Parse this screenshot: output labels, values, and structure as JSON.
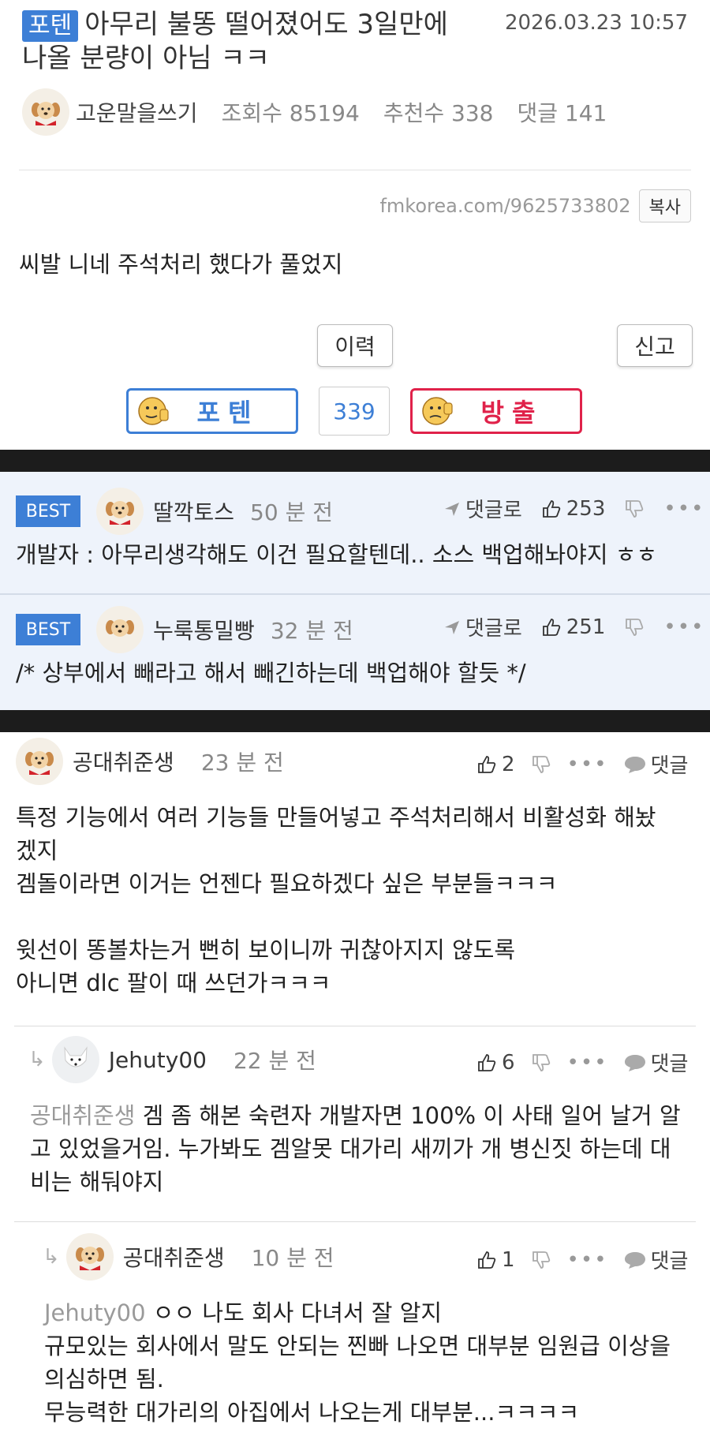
{
  "post": {
    "category": "포텐",
    "title_line1": "아무리 불똥 떨어졌어도 3일만에",
    "title_line2": "나올 분량이 아님 ㅋㅋ",
    "date": "2026.03.23 10:57",
    "author": "고운말을쓰기",
    "views": "조회수 85194",
    "recommends": "추천수 338",
    "comments": "댓글 141",
    "url": "fmkorea.com/9625733802",
    "copy_label": "복사",
    "body": "씨발 니네 주석처리 했다가 풀었지",
    "history_label": "이력",
    "report_label": "신고",
    "upvote_label": "포텐",
    "downvote_label": "방출",
    "vote_count": "339"
  },
  "colors": {
    "accent": "#3d7fd6",
    "down": "#e0224a",
    "best_bg": "#eef3fb"
  },
  "best_comments": [
    {
      "badge": "BEST",
      "author": "딸깍토스",
      "time": "50 분 전",
      "reply_label": "댓글로",
      "likes": "253",
      "text": "개발자 : 아무리생각해도 이건 필요할텐데.. 소스 백업해놔야지 ㅎㅎ"
    },
    {
      "badge": "BEST",
      "author": "누룩통밀빵",
      "time": "32 분 전",
      "reply_label": "댓글로",
      "likes": "251",
      "text": "/* 상부에서 빼라고 해서 빼긴하는데 백업해야 할듯 */"
    }
  ],
  "comments": [
    {
      "author": "공대취준생",
      "time": "23 분 전",
      "likes": "2",
      "reply_label": "댓글",
      "text": "특정 기능에서 여러 기능들 만들어넣고 주석처리해서 비활성화 해놨\n겠지\n겜돌이라면 이거는 언젠다 필요하겠다 싶은 부분들ㅋㅋㅋ\n\n윗선이 똥볼차는거 뻔히 보이니까 귀찮아지지 않도록\n아니면 dlc 팔이 때 쓰던가ㅋㅋㅋ"
    },
    {
      "author": "Jehuty00",
      "time": "22 분 전",
      "likes": "6",
      "reply_label": "댓글",
      "mention": "공대취준생",
      "text_line1": " 겜 좀 해본 숙련자 개발자면 100% 이 사태 일어 날거 알",
      "text_rest": "고 있었을거임. 누가봐도 겜알못 대가리 새끼가 개 병신짓 하는데 대\n비는 해둬야지"
    },
    {
      "author": "공대취준생",
      "time": "10 분 전",
      "likes": "1",
      "reply_label": "댓글",
      "mention": "Jehuty00",
      "text_line1": " ㅇㅇ 나도 회사 다녀서 잘 알지",
      "text_rest": "규모있는 회사에서 말도 안되는 찐빠 나오면 대부분 임원급 이상을\n의심하면 됨.\n무능력한 대가리의 아집에서 나오는게 대부분...ㅋㅋㅋㅋ"
    }
  ]
}
